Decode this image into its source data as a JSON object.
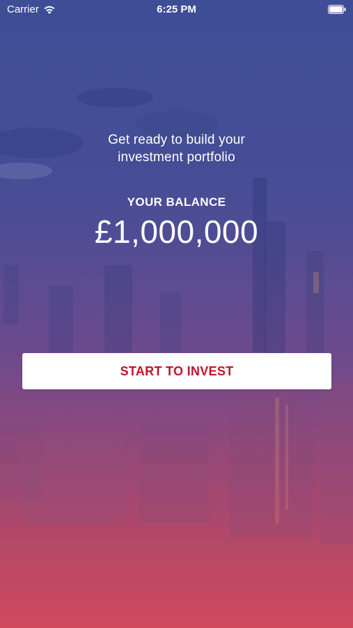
{
  "status_bar": {
    "carrier": "Carrier",
    "time": "6:25 PM"
  },
  "hero": {
    "tagline_line1": "Get ready to build your",
    "tagline_line2": "investment portfolio"
  },
  "balance": {
    "label": "YOUR BALANCE",
    "value": "£1,000,000"
  },
  "actions": {
    "start_invest_label": "START TO INVEST"
  },
  "icons": {
    "wifi": "wifi-icon",
    "battery": "battery-icon"
  },
  "colors": {
    "top_gradient": "#3f4f96",
    "bottom_gradient": "#d24a5c",
    "button_text": "#c0142c",
    "button_bg": "#ffffff"
  }
}
